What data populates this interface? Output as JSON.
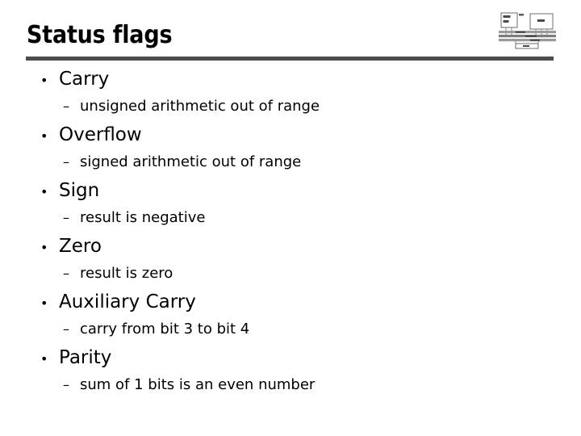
{
  "slide": {
    "title": "Status flags",
    "divider_color": "#4d4d4d",
    "background_color": "#ffffff",
    "text_color": "#000000"
  },
  "corner_graphic": {
    "name": "computer-bus-block-diagram",
    "description": "small grayscale block diagram of CPU, memory and system buses"
  },
  "bullets": {
    "marker": "•",
    "sub_marker": "–",
    "items": [
      {
        "label": "Carry",
        "detail": "unsigned arithmetic out of range"
      },
      {
        "label": "Overflow",
        "detail": "signed arithmetic out of range"
      },
      {
        "label": "Sign",
        "detail": "result is negative"
      },
      {
        "label": "Zero",
        "detail": "result is zero"
      },
      {
        "label": "Auxiliary Carry",
        "detail": "carry from bit 3 to bit 4"
      },
      {
        "label": "Parity",
        "detail": "sum of 1 bits is an even number"
      }
    ]
  }
}
